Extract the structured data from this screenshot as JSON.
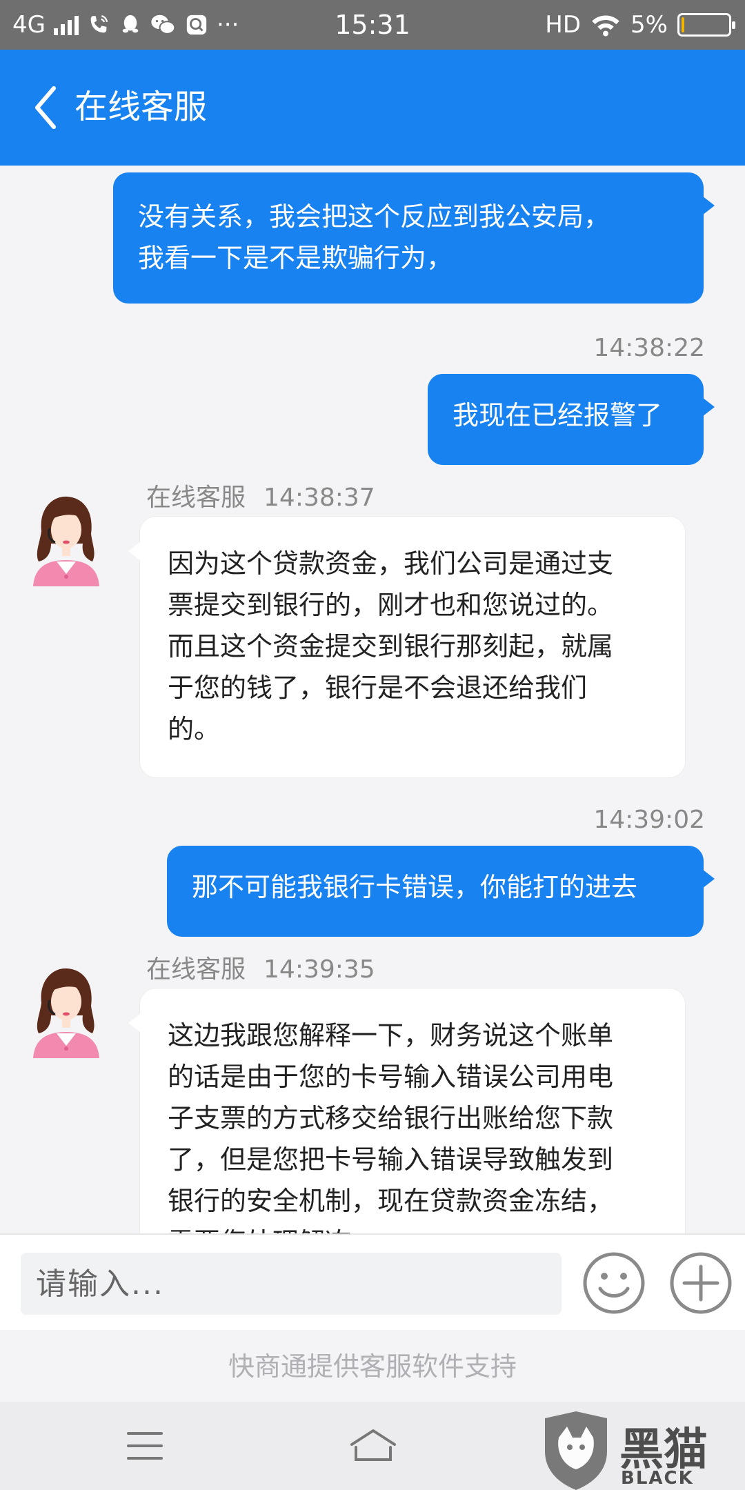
{
  "status_bar": {
    "network": "4G",
    "time": "15:31",
    "hd": "HD",
    "battery_percent": "5%",
    "battery_level": 0.05,
    "more": "···",
    "accent": "#f1b400"
  },
  "header": {
    "title": "在线客服",
    "back_icon": "chevron-left-icon",
    "background": "#1882f0"
  },
  "messages": [
    {
      "sender": "me",
      "text": "没有关系，我会把这个反应到我公安局，\n我看一下是不是欺骗行为，",
      "time": ""
    },
    {
      "sender": "me",
      "text": "我现在已经报警了",
      "time": "14:38:22"
    },
    {
      "sender": "agent",
      "name": "在线客服",
      "time": "14:38:37",
      "text": "因为这个贷款资金，我们公司是通过支\n票提交到银行的，刚才也和您说过的。\n而且这个资金提交到银行那刻起，就属\n于您的钱了，银行是不会退还给我们\n的。"
    },
    {
      "sender": "me",
      "text": "那不可能我银行卡错误，你能打的进去",
      "time": "14:39:02"
    },
    {
      "sender": "agent",
      "name": "在线客服",
      "time": "14:39:35",
      "text": "这边我跟您解释一下，财务说这个账单\n的话是由于您的卡号输入错误公司用电\n子支票的方式移交给银行出账给您下款\n了，但是您把卡号输入错误导致触发到\n银行的安全机制，现在贷款资金冻结，\n需要您处理解冻"
    }
  ],
  "composer": {
    "placeholder": "请输入...",
    "emoji_icon": "smiley-icon",
    "add_icon": "plus-circle-icon"
  },
  "footer": {
    "text": "快商通提供客服软件支持"
  },
  "nav": {
    "menu_icon": "menu-icon",
    "home_icon": "home-icon"
  },
  "watermark": {
    "logo_text": "黑猫",
    "sub_text": "BLACK CAT"
  }
}
